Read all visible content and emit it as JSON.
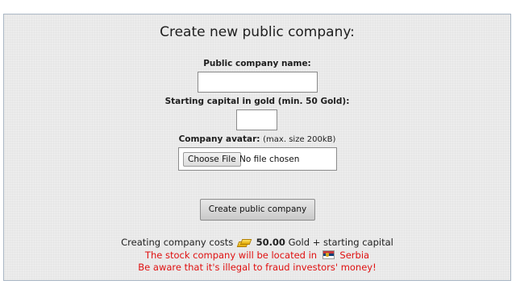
{
  "form": {
    "title": "Create new public company:",
    "name_label": "Public company name:",
    "name_value": "",
    "capital_label": "Starting capital in gold (min. 50 Gold):",
    "capital_value": "",
    "avatar_label": "Company avatar:",
    "avatar_note": "(max. size 200kB)",
    "choose_file_label": "Choose File",
    "file_status": "No file chosen",
    "submit_label": "Create public company"
  },
  "info": {
    "cost_prefix": "Creating company costs",
    "cost_amount": "50.00",
    "cost_suffix": "Gold + starting capital",
    "location_prefix": "The stock company will be located in",
    "location_country": "Serbia",
    "warning": "Be aware that it's illegal to fraud investors' money!"
  },
  "icons": {
    "currency": "gold-bars-icon",
    "country_flag": "serbia-flag-icon"
  },
  "colors": {
    "warning_text": "#e01010",
    "panel_border": "#a9b6c4",
    "panel_background": "#ececec"
  }
}
